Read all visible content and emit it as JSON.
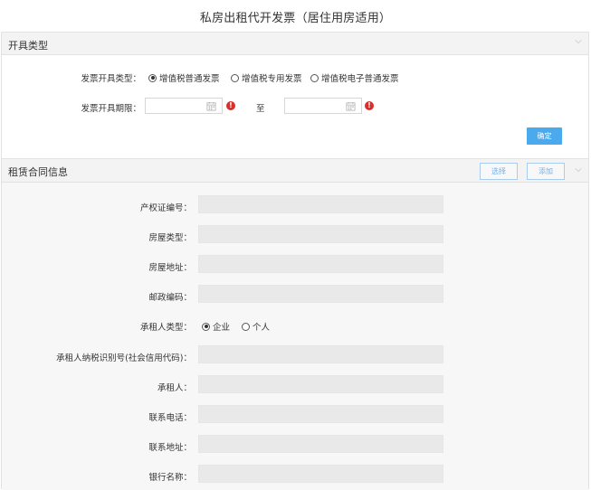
{
  "page": {
    "title": "私房出租代开发票（居住用房适用）"
  },
  "invoice_section": {
    "title": "开具类型",
    "type_label": "发票开具类型：",
    "type_options": [
      {
        "label": "增值税普通发票",
        "selected": true
      },
      {
        "label": "增值税专用发票",
        "selected": false
      },
      {
        "label": "增值税电子普通发票",
        "selected": false
      }
    ],
    "period_label": "发票开具期限：",
    "period_start": "",
    "period_end": "",
    "to_label": "至",
    "confirm_label": "确定"
  },
  "lease_section": {
    "title": "租赁合同信息",
    "select_label": "选择",
    "add_label": "添加",
    "fields": {
      "property_cert_label": "产权证编号：",
      "house_type_label": "房屋类型：",
      "house_address_label": "房屋地址：",
      "postal_code_label": "邮政编码：",
      "tenant_type_label": "承租人类型：",
      "tenant_type_options": [
        {
          "label": "企业",
          "selected": true
        },
        {
          "label": "个人",
          "selected": false
        }
      ],
      "tenant_taxid_label": "承租人纳税识别号(社会信用代码)：",
      "tenant_label": "承租人：",
      "phone_label": "联系电话：",
      "contact_address_label": "联系地址：",
      "bank_name_label": "银行名称："
    }
  },
  "colors": {
    "primary": "#4ba9ee",
    "warning": "#d9302b",
    "header_bg": "#f3f3f3",
    "field_bg": "#e9e9e9"
  }
}
